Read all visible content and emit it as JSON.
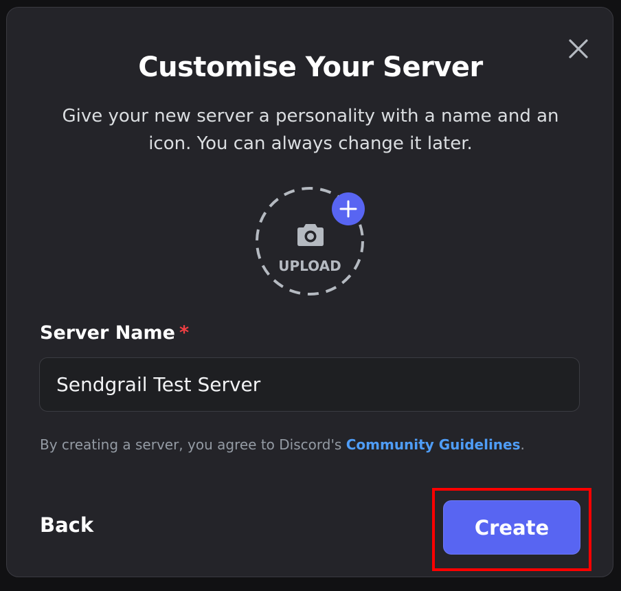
{
  "modal": {
    "title": "Customise Your Server",
    "subtitle": "Give your new server a personality with a name and an icon. You can always change it later.",
    "close_icon": "close-icon"
  },
  "upload": {
    "label": "UPLOAD",
    "camera_icon": "camera-icon",
    "plus_icon": "plus-icon"
  },
  "server_name": {
    "label": "Server Name",
    "required_mark": "*",
    "value": "Sendgrail Test Server"
  },
  "terms": {
    "prefix": "By creating a server, you agree to Discord's ",
    "link": "Community Guidelines",
    "suffix": "."
  },
  "footer": {
    "back_label": "Back",
    "create_label": "Create"
  },
  "colors": {
    "modal_bg": "#242429",
    "accent": "#5865f2",
    "link": "#4f9df7",
    "required": "#f23f43",
    "highlight": "#ff0000"
  }
}
